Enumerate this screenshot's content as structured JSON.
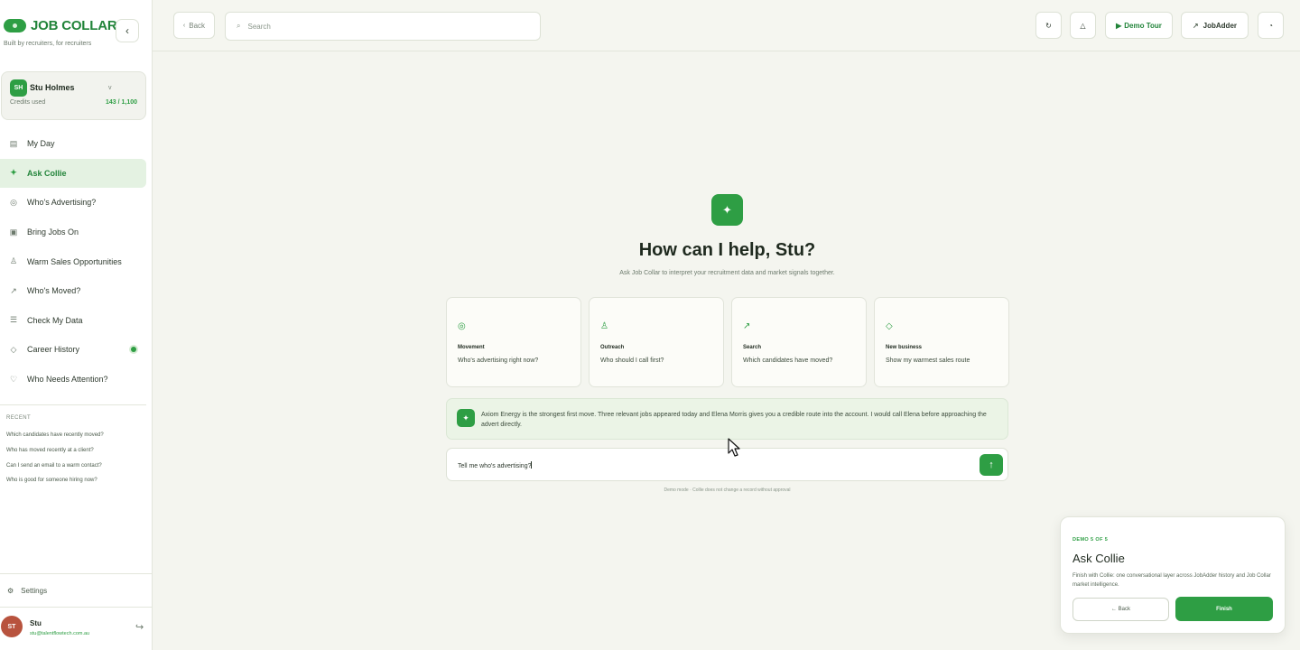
{
  "sidebar": {
    "brand": "JOB COLLAR",
    "tagline": "Built by recruiters, for recruiters",
    "account": {
      "initials": "SH",
      "name": "Stu Holmes",
      "credits_label": "Credits used",
      "credits_value": "143 / 1,100"
    },
    "nav": [
      {
        "label": "My Day",
        "icon": "▤"
      },
      {
        "label": "Ask Collie",
        "icon": "✦"
      },
      {
        "label": "Who's Advertising?",
        "icon": "◎"
      },
      {
        "label": "Bring Jobs On",
        "icon": "▣"
      },
      {
        "label": "Warm Sales Opportunities",
        "icon": "♙"
      },
      {
        "label": "Who's Moved?",
        "icon": "↗"
      },
      {
        "label": "Check My Data",
        "icon": "☰"
      },
      {
        "label": "Career History",
        "icon": "◇"
      },
      {
        "label": "Who Needs Attention?",
        "icon": "♡"
      }
    ],
    "recent_label": "RECENT",
    "recent": [
      "Which candidates have recently moved?",
      "Who has moved recently at a client?",
      "Can I send an email to a warm contact?",
      "Who is good for someone hiring now?"
    ],
    "settings": "Settings",
    "user": {
      "initials": "ST",
      "name": "Stu",
      "email": "stu@talentflowtech.com.au"
    }
  },
  "topbar": {
    "back": "Back",
    "search_placeholder": "Search",
    "demo_tour": "Demo Tour",
    "jobadder": "JobAdder"
  },
  "main": {
    "title": "How can I help, Stu?",
    "subtitle": "Ask Job Collar to interpret your recruitment data and market signals together.",
    "cards": [
      {
        "icon": "◎",
        "title": "Movement",
        "text": "Who's advertising right now?"
      },
      {
        "icon": "♙",
        "title": "Outreach",
        "text": "Who should I call first?"
      },
      {
        "icon": "↗",
        "title": "Search",
        "text": "Which candidates have moved?"
      },
      {
        "icon": "◇",
        "title": "New business",
        "text": "Show my warmest sales route"
      }
    ],
    "answer": "Axiom Energy is the strongest first move. Three relevant jobs appeared today and Elena Morris gives you a credible route into the account. I would call Elena before approaching the advert directly.",
    "input_value": "Tell me who's advertising?",
    "disclaimer": "Demo mode · Collie does not change a record without approval"
  },
  "tour": {
    "step": "DEMO 5 OF 5",
    "title": "Ask Collie",
    "text": "Finish with Collie: one conversational layer across JobAdder history and Job Collar market intelligence.",
    "back": "← Back",
    "finish": "Finish"
  }
}
